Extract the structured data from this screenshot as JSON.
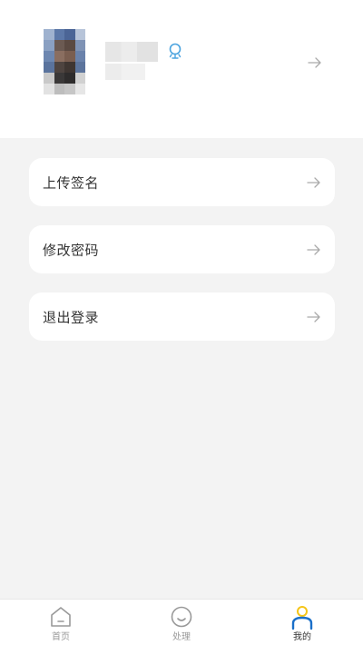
{
  "menu": {
    "items": [
      {
        "label": "上传签名"
      },
      {
        "label": "修改密码"
      },
      {
        "label": "退出登录"
      }
    ]
  },
  "tabbar": {
    "tabs": [
      {
        "label": "首页",
        "icon": "home-icon",
        "active": false
      },
      {
        "label": "处理",
        "icon": "smile-icon",
        "active": false
      },
      {
        "label": "我的",
        "icon": "user-icon",
        "active": true
      }
    ]
  },
  "colors": {
    "accent_yellow": "#f5c518",
    "accent_blue": "#1a6fc9",
    "gender_icon": "#4aa3df",
    "background": "#f3f3f3",
    "card": "#ffffff",
    "text": "#333333",
    "muted": "#999999"
  }
}
